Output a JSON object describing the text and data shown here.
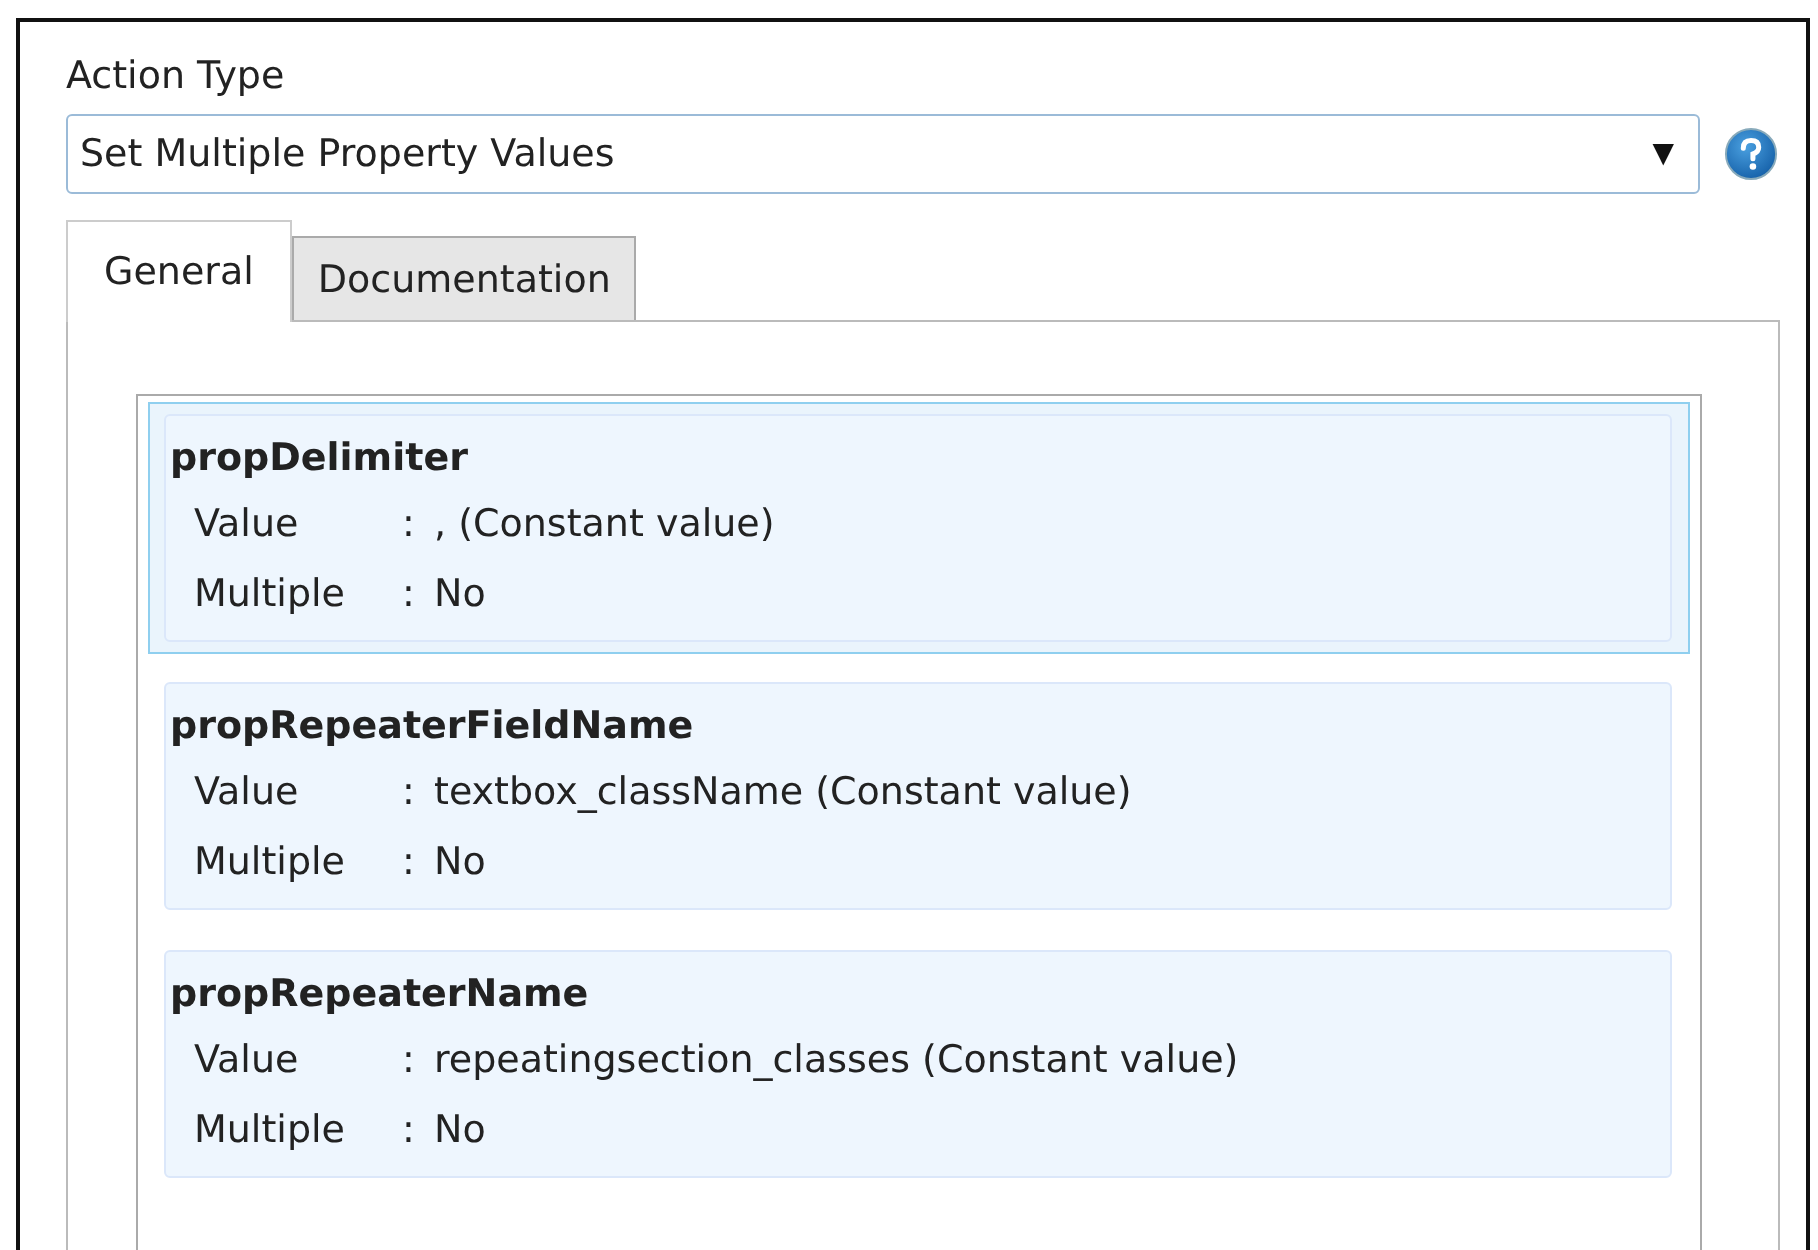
{
  "action_type": {
    "label": "Action Type",
    "value": "Set Multiple Property Values",
    "dropdown_arrow": "▼"
  },
  "tabs": [
    {
      "label": "General",
      "selected": true
    },
    {
      "label": "Documentation",
      "selected": false
    }
  ],
  "properties": [
    {
      "name": "propDelimiter",
      "selected": true,
      "fields": [
        {
          "label": "Value",
          "separator": ":",
          "value": ", (Constant value)"
        },
        {
          "label": "Multiple",
          "separator": ":",
          "value": "No"
        }
      ]
    },
    {
      "name": "propRepeaterFieldName",
      "selected": false,
      "fields": [
        {
          "label": "Value",
          "separator": ":",
          "value": "textbox_className (Constant value)"
        },
        {
          "label": "Multiple",
          "separator": ":",
          "value": "No"
        }
      ]
    },
    {
      "name": "propRepeaterName",
      "selected": false,
      "fields": [
        {
          "label": "Value",
          "separator": ":",
          "value": "repeatingsection_classes (Constant value)"
        },
        {
          "label": "Multiple",
          "separator": ":",
          "value": "No"
        }
      ]
    }
  ]
}
